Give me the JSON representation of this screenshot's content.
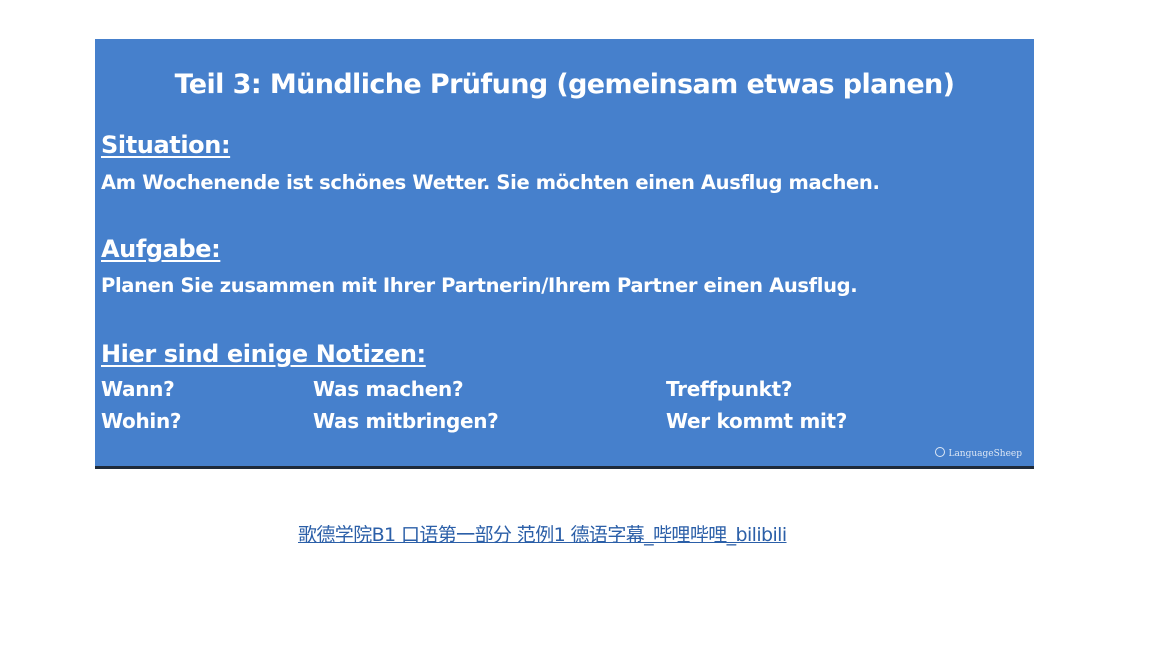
{
  "slide": {
    "title": "Teil 3: Mündliche Prüfung (gemeinsam etwas planen)",
    "situation": {
      "heading": "Situation:",
      "text": "Am Wochenende ist schönes Wetter. Sie möchten einen Ausflug machen."
    },
    "aufgabe": {
      "heading": "Aufgabe:",
      "text": "Planen Sie zusammen mit Ihrer Partnerin/Ihrem Partner einen Ausflug."
    },
    "notizen": {
      "heading": "Hier sind einige Notizen:",
      "items": [
        "Wann?",
        "Was machen?",
        "Treffpunkt?",
        "Wohin?",
        "Was mitbringen?",
        "Wer kommt mit?"
      ]
    },
    "watermark": "LanguageSheep",
    "colors": {
      "background": "#4680cc",
      "text": "#ffffff"
    }
  },
  "link": {
    "text": "歌德学院B1 口语第一部分 范例1 德语字幕_哔哩哔哩_bilibili",
    "color": "#2b5fa8"
  }
}
